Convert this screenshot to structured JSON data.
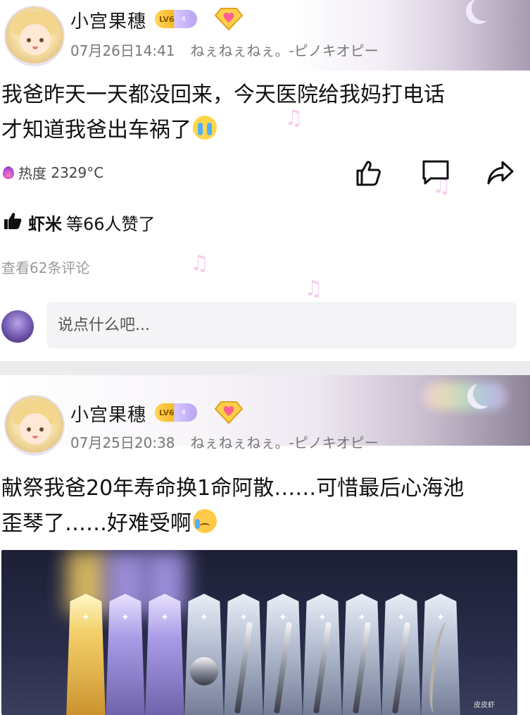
{
  "posts": [
    {
      "username": "小宫果穗",
      "level_badge": "LV6",
      "level_num": "4",
      "date": "07月26日14:41",
      "signature": "ねぇねぇねぇ。-ピノキオピー",
      "content_line1": "我爸昨天一天都没回来，今天医院给我妈打电话",
      "content_line2": "才知道我爸出车祸了",
      "content_emoji": "crying-emoji",
      "heat_label": "热度",
      "heat_value": "2329°C",
      "likes_name": "虾米",
      "likes_text": "等66人赞了",
      "view_comments": "查看62条评论",
      "comment_placeholder": "说点什么吧..."
    },
    {
      "username": "小宫果穗",
      "level_badge": "LV6",
      "level_num": "4",
      "date": "07月25日20:38",
      "signature": "ねぇねぇねぇ。-ピノキオピー",
      "content_line1": "献祭我爸20年寿命换1命阿散……可惜最后心海池",
      "content_line2": "歪琴了……好难受啊",
      "content_emoji": "sad-emoji",
      "image_watermark": "皮皮虾"
    }
  ],
  "icons": {
    "like": "thumbs-up-icon",
    "comment": "comment-icon",
    "share": "share-icon",
    "heat": "flame-icon"
  },
  "colors": {
    "text": "#111111",
    "meta": "#777777",
    "muted": "#9a9a9a",
    "separator": "#ececee"
  }
}
